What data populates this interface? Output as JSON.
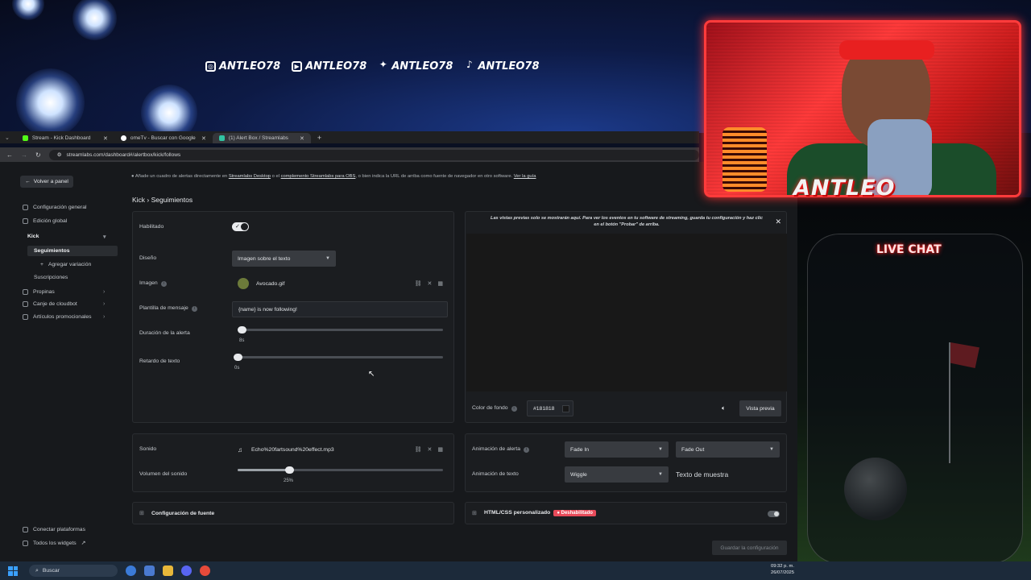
{
  "overlay": {
    "socials": [
      {
        "icon": "instagram-icon",
        "handle": "ANTLEO78"
      },
      {
        "icon": "youtube-icon",
        "handle": "ANTLEO78"
      },
      {
        "icon": "twitter-icon",
        "handle": "ANTLEO78"
      },
      {
        "icon": "tiktok-icon",
        "handle": "ANTLEO78"
      }
    ],
    "brand_name": "ANTLEO",
    "chat_title": "LIVE CHAT"
  },
  "browser": {
    "tabs": [
      {
        "title": "Stream - Kick Dashboard",
        "favicon_color": "#53fc18"
      },
      {
        "title": "omeTv - Buscar con Google",
        "favicon_color": "#ffffff"
      },
      {
        "title": "(1) Alert Box / Streamlabs",
        "favicon_color": "#31c3a2"
      }
    ],
    "new_tab": "+",
    "url": "streamlabs.com/dashboard#/alertbox/kick/follows"
  },
  "sidebar": {
    "back_label": "Volver a panel",
    "items": [
      {
        "label": "Configuración general"
      },
      {
        "label": "Edición global"
      },
      {
        "label": "Kick"
      },
      {
        "label": "Seguimientos"
      },
      {
        "label": "Agregar variación"
      },
      {
        "label": "Suscripciones"
      },
      {
        "label": "Propinas"
      },
      {
        "label": "Canje de cloudbot"
      },
      {
        "label": "Artículos promocionales"
      }
    ],
    "bottom": [
      {
        "label": "Conectar plataformas"
      },
      {
        "label": "Todos los widgets"
      }
    ]
  },
  "info": {
    "text_1": "Añade un cuadro de alertas directamente en ",
    "link_1": "Streamlabs Desktop",
    "text_2": " o el ",
    "link_2": "complemento Streamlabs para OBS",
    "text_3": ", o bien indica la URL de arriba como fuente de navegador en otro software. ",
    "link_3": "Ver la guía"
  },
  "breadcrumb": "Kick › Seguimientos",
  "settings": {
    "enabled_label": "Habilitado",
    "design_label": "Diseño",
    "design_value": "Imagen sobre el texto",
    "image_label": "Imagen",
    "image_value": "Avocado.gif",
    "template_label": "Plantilla de mensaje",
    "template_value": "{name} is now following!",
    "duration_label": "Duración de la alerta",
    "duration_value": "8s",
    "duration_fraction": 0.02,
    "text_delay_label": "Retardo de texto",
    "text_delay_value": "0s",
    "text_delay_fraction": 0.0
  },
  "preview": {
    "message": "Las vistas previas solo se mostrarán aquí. Para ver los eventos en tu software de streaming, guarda tu configuración y haz clic en el botón \"Probar\" de arriba.",
    "bg_label": "Color de fondo",
    "bg_value": "#181818",
    "preview_button": "Vista previa"
  },
  "sound": {
    "sound_label": "Sonido",
    "sound_value": "Echo%20fartsound%20effect.mp3",
    "volume_label": "Volumen del sonido",
    "volume_value": "25%",
    "volume_fraction": 0.25
  },
  "animation": {
    "alert_anim_label": "Animación de alerta",
    "anim_in": "Fade In",
    "anim_out": "Fade Out",
    "text_anim_label": "Animación de texto",
    "text_anim_value": "Wiggle",
    "sample_text": "Texto de muestra"
  },
  "font_section": "Configuración de fuente",
  "custom_css": {
    "label": "HTML/CSS personalizado",
    "badge": "Deshabilitado"
  },
  "save_button": "Guardar la configuración",
  "taskbar": {
    "search": "Buscar",
    "time": "09:32 p. m.",
    "date": "26/07/2025"
  }
}
